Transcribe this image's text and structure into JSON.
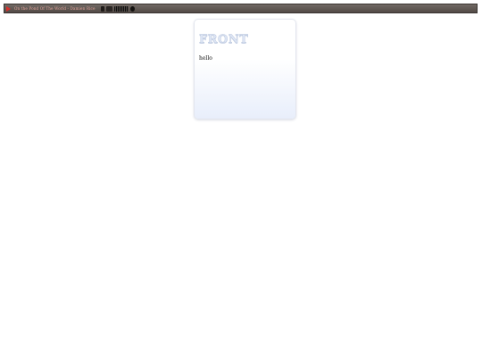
{
  "player": {
    "track_title": "On the Pond Of The World - Damien Rice",
    "controls": [
      "play",
      "prev",
      "next",
      "volume",
      "seek",
      "visibility"
    ]
  },
  "card": {
    "title": "FRONT",
    "body": "hello"
  },
  "colors": {
    "bar": "#5e5651",
    "play": "#d9302c",
    "card_title": "#dde5f4",
    "card_bg_bottom": "#e8eefb"
  }
}
